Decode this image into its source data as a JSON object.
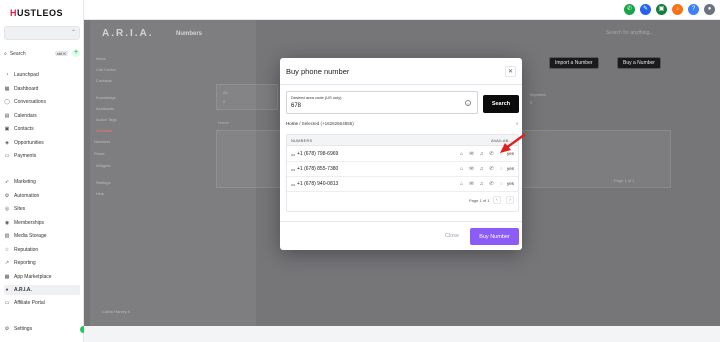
{
  "brand": {
    "lead": "H",
    "rest": "USTLEOS"
  },
  "sidebar": {
    "search_label": "Search",
    "search_shortcut": "ctrl K",
    "items": [
      {
        "label": "Launchpad",
        "icon": "rocket-icon",
        "glyph": "◔"
      },
      {
        "label": "Dashboard",
        "icon": "dashboard-icon",
        "glyph": "▦"
      },
      {
        "label": "Conversations",
        "icon": "chat-icon",
        "glyph": "◯"
      },
      {
        "label": "Calendars",
        "icon": "calendar-icon",
        "glyph": "▤"
      },
      {
        "label": "Contacts",
        "icon": "contacts-icon",
        "glyph": "▣"
      },
      {
        "label": "Opportunities",
        "icon": "opportunities-icon",
        "glyph": "◈"
      },
      {
        "label": "Payments",
        "icon": "payments-icon",
        "glyph": "▭"
      },
      {
        "label": "Marketing",
        "icon": "marketing-icon",
        "glyph": "➶"
      },
      {
        "label": "Automation",
        "icon": "automation-icon",
        "glyph": "⚙"
      },
      {
        "label": "Sites",
        "icon": "sites-icon",
        "glyph": "◎"
      },
      {
        "label": "Memberships",
        "icon": "memberships-icon",
        "glyph": "◉"
      },
      {
        "label": "Media Storage",
        "icon": "media-icon",
        "glyph": "▧"
      },
      {
        "label": "Reputation",
        "icon": "star-icon",
        "glyph": "☆"
      },
      {
        "label": "Reporting",
        "icon": "chart-icon",
        "glyph": "↗"
      },
      {
        "label": "App Marketplace",
        "icon": "apps-icon",
        "glyph": "▦"
      },
      {
        "label": "A.R.I.A.",
        "icon": "aria-icon",
        "glyph": "●",
        "active": true
      },
      {
        "label": "Affiliate Portal",
        "icon": "affiliate-icon",
        "glyph": "▭"
      }
    ],
    "settings_label": "Settings"
  },
  "background": {
    "app_title": "A.R.I.A.",
    "page_title": "Numbers",
    "search_placeholder": "Search for anything...",
    "import_button": "Import a Number",
    "buy_button": "Buy a Number",
    "sub_nav": [
      "Inbox",
      "Call Center",
      "Contacts",
      "Knowledge",
      "Assistants",
      "Action Tags",
      "Numbers",
      "Numbers",
      "Flows",
      "Widgets",
      "Settings",
      "Help"
    ],
    "imported_label": "Imported",
    "imported_value": "0",
    "stat_label": "All",
    "stat_value": "0",
    "home_label": "Home",
    "pagination": "Page 1 of 1",
    "user_name": "Calvin Harvey II"
  },
  "modal": {
    "title": "Buy phone number",
    "close_icon": "close-icon",
    "area_label": "Desired area code (US only)",
    "area_value": "678",
    "search_button": "Search",
    "breadcrumb_home": "Home",
    "breadcrumb_selected": "/ Selected (+16262664856)",
    "breadcrumb_suffix": "0",
    "columns": {
      "numbers": "NUMBERS",
      "available": "AVAILAB..."
    },
    "rows": [
      {
        "country": "us",
        "number": "+1 (678) 798-6969",
        "available": "yes"
      },
      {
        "country": "us",
        "number": "+1 (678) 855-7380",
        "available": "yes"
      },
      {
        "country": "us",
        "number": "+1 (678) 940-0813",
        "available": "yes"
      }
    ],
    "pagination": "Page 1 of 1",
    "close_link": "Close",
    "buy_button": "Buy Number"
  },
  "colors": {
    "accent": "#8b5cf6",
    "brand_red": "#e11d48",
    "arrow_red": "#e11d1d"
  }
}
